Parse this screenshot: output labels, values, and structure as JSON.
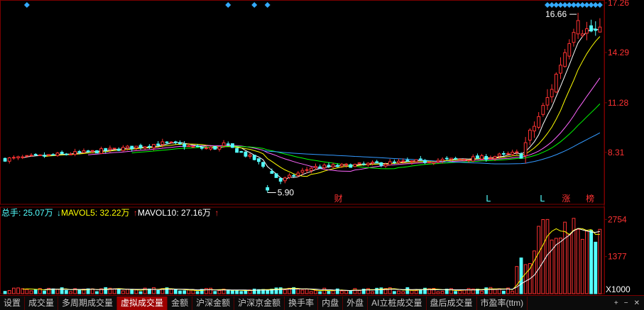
{
  "colors": {
    "background": "#000000",
    "grid": "#7a0000",
    "up": "#ff3232",
    "down": "#54ffff",
    "ma5": "#ffffff",
    "ma10": "#ffff00",
    "ma20": "#ff66ff",
    "ma30": "#00ff00",
    "ma60": "#3399ff",
    "flag": "#33aaff",
    "axis_text": "#ff3232",
    "legend_total": "#54ffff",
    "legend_ma5": "#ffff00",
    "legend_ma10": "#ffffff"
  },
  "chart_data": [
    {
      "type": "candlestick",
      "y_ticks": [
        "17.26",
        "14.29",
        "11.28",
        "8.31"
      ],
      "ylim": [
        5.2,
        17.26
      ],
      "max_label": "16.66",
      "min_label": "5.90",
      "event_markers": [
        "财",
        "L",
        "L",
        "涨",
        "榜"
      ],
      "candles": [],
      "ma_lines": [
        "MA5",
        "MA10",
        "MA20",
        "MA30",
        "MA60"
      ]
    },
    {
      "type": "bar",
      "y_ticks": [
        "2754",
        "1377"
      ],
      "unit_label": "X1000",
      "ylim": [
        0,
        3000
      ],
      "values": []
    }
  ],
  "legend": {
    "total_label": "总手: 25.07万",
    "ma5_arrow": "↓",
    "ma5_label": "MAVOL5: 32.22万",
    "ma10_arrow": "↑",
    "ma10_label": "MAVOL10: 27.16万",
    "trail_arrow": "↑"
  },
  "tabs": [
    {
      "label": "设置",
      "active": false
    },
    {
      "label": "成交量",
      "active": false
    },
    {
      "label": "多周期成交量",
      "active": false
    },
    {
      "label": "虚拟成交量",
      "active": true
    },
    {
      "label": "金额",
      "active": false
    },
    {
      "label": "沪深金额",
      "active": false
    },
    {
      "label": "沪深京金额",
      "active": false
    },
    {
      "label": "换手率",
      "active": false
    },
    {
      "label": "内盘",
      "active": false
    },
    {
      "label": "外盘",
      "active": false
    },
    {
      "label": "AI立桩成交量",
      "active": false
    },
    {
      "label": "盘后成交量",
      "active": false
    },
    {
      "label": "市盈率(ttm)",
      "active": false
    }
  ],
  "tab_controls": {
    "plus": "+",
    "minus": "−",
    "close": "✕"
  }
}
